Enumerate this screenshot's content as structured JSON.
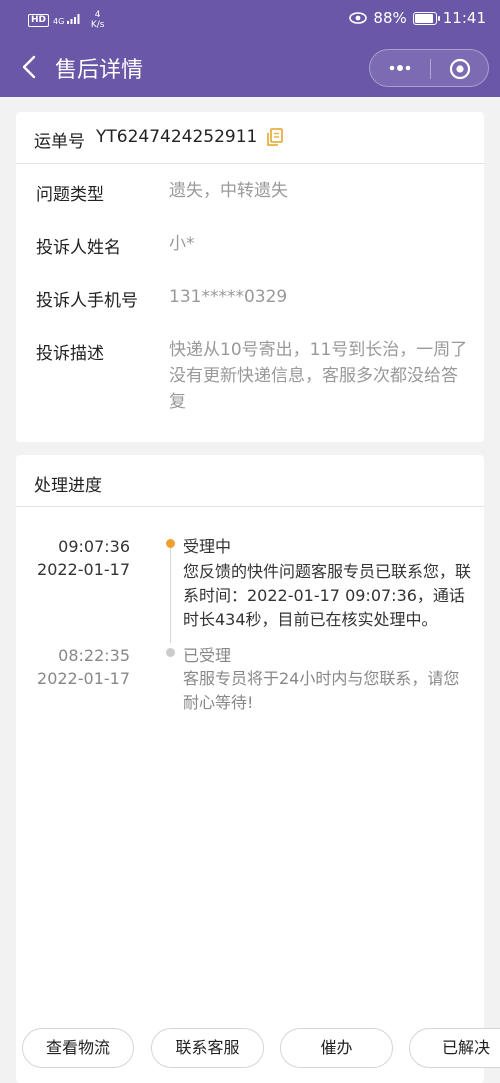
{
  "status_bar": {
    "hd": "HD",
    "network": "4G",
    "speed_value": "4",
    "speed_unit": "K/s",
    "battery": "88%",
    "time": "11:41"
  },
  "nav": {
    "title": "售后详情",
    "more_icon": "more-dots-icon",
    "close_icon": "target-icon"
  },
  "order": {
    "waybill_label": "运单号",
    "waybill_no": "YT6247424252911",
    "copy_icon": "copy-icon",
    "fields": [
      {
        "label": "问题类型",
        "value": "遗失，中转遗失"
      },
      {
        "label": "投诉人姓名",
        "value": "小*"
      },
      {
        "label": "投诉人手机号",
        "value": "131*****0329"
      },
      {
        "label": "投诉描述",
        "value": "快递从10号寄出，11号到长治，一周了没有更新快递信息，客服多次都没给答复"
      }
    ]
  },
  "progress": {
    "title": "处理进度",
    "items": [
      {
        "time": "09:07:36",
        "date": "2022-01-17",
        "status": "受理中",
        "desc": "您反馈的快件问题客服专员已联系您，联系时间：2022-01-17 09:07:36，通话时长434秒，目前已在核实处理中。",
        "dot_color": "#f0a030"
      },
      {
        "time": "08:22:35",
        "date": "2022-01-17",
        "status": "已受理",
        "desc": "客服专员将于24小时内与您联系，请您耐心等待!",
        "dot_color": "#cccccc"
      }
    ]
  },
  "actions": {
    "logistics": "查看物流",
    "contact": "联系客服",
    "urge": "催办",
    "resolved": "已解决"
  },
  "colors": {
    "header": "#6a57a8",
    "accent": "#f0a030"
  }
}
